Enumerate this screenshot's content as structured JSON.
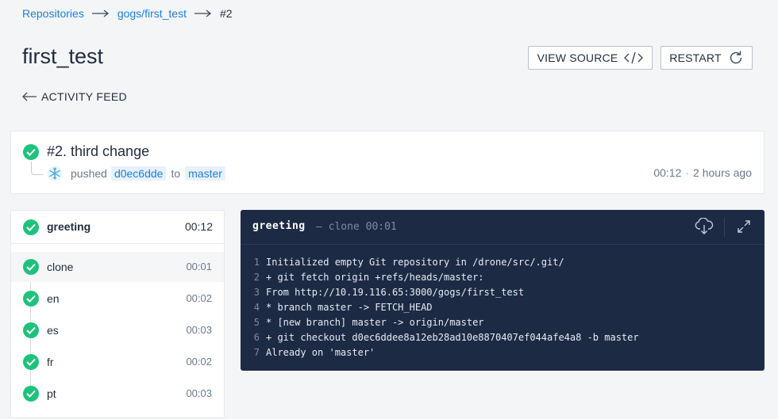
{
  "breadcrumb": {
    "repositories": "Repositories",
    "repo": "gogs/first_test",
    "build": "#2"
  },
  "page_title": "first_test",
  "buttons": {
    "view_source": "VIEW SOURCE",
    "restart": "RESTART"
  },
  "back_link": "ACTIVITY FEED",
  "build": {
    "title": "#2. third change",
    "action": "pushed",
    "commit": "d0ec6dde",
    "to": "to",
    "branch": "master",
    "duration": "00:12",
    "dot": "·",
    "ago": "2 hours ago",
    "status": "success"
  },
  "stage": {
    "name": "greeting",
    "duration": "00:12",
    "steps": [
      {
        "name": "clone",
        "duration": "00:01"
      },
      {
        "name": "en",
        "duration": "00:02"
      },
      {
        "name": "es",
        "duration": "00:03"
      },
      {
        "name": "fr",
        "duration": "00:02"
      },
      {
        "name": "pt",
        "duration": "00:03"
      }
    ]
  },
  "log": {
    "stage": "greeting",
    "separator": "—",
    "step": "clone",
    "duration": "00:01",
    "lines": [
      {
        "n": "1",
        "text": "Initialized empty Git repository in /drone/src/.git/"
      },
      {
        "n": "2",
        "text": "+ git fetch origin +refs/heads/master:"
      },
      {
        "n": "3",
        "text": "From http://10.19.116.65:3000/gogs/first_test"
      },
      {
        "n": "4",
        "text": "* branch master -> FETCH_HEAD"
      },
      {
        "n": "5",
        "text": "* [new branch] master -> origin/master"
      },
      {
        "n": "6",
        "text": "+ git checkout d0ec6ddee8a12eb28ad10e8870407ef044afe4a8 -b master"
      },
      {
        "n": "7",
        "text": "Already on 'master'"
      }
    ]
  },
  "colors": {
    "success": "#1ec27c",
    "link": "#1e7fd6",
    "log_bg": "#1d2a44"
  },
  "icons": {
    "source": "code-icon",
    "restart": "refresh-icon",
    "back": "arrow-left-icon",
    "status": "check-circle-icon",
    "download": "download-cloud-icon",
    "expand": "expand-icon",
    "avatar": "snowflake-avatar-icon"
  }
}
